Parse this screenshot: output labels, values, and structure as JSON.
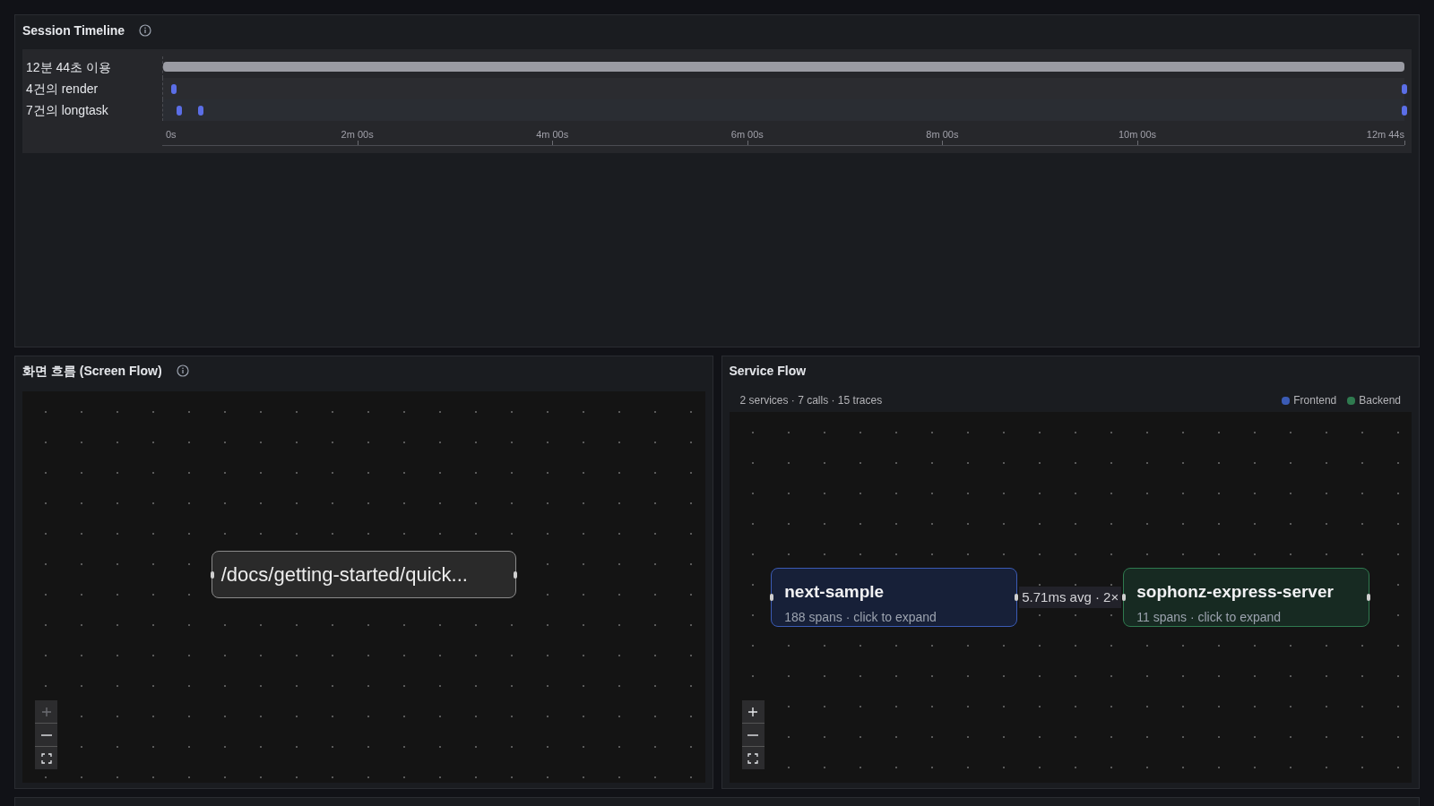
{
  "session_timeline": {
    "title": "Session Timeline",
    "rows": [
      {
        "kind": "span",
        "label": "12분 44초 이용",
        "level": 1
      },
      {
        "kind": "events",
        "label": "4건의 render",
        "markers": [
          {
            "level": 0.009
          },
          {
            "level": 1
          }
        ]
      },
      {
        "kind": "events",
        "label": "7건의 longtask",
        "markers": [
          {
            "level": 0.013
          },
          {
            "level": 0.03
          },
          {
            "level": 1
          }
        ]
      }
    ],
    "ticks": [
      {
        "label": "0s",
        "level": 0
      },
      {
        "label": "2m 00s",
        "level": 0.157
      },
      {
        "label": "4m 00s",
        "level": 0.314
      },
      {
        "label": "6m 00s",
        "level": 0.471
      },
      {
        "label": "8m 00s",
        "level": 0.628
      },
      {
        "label": "10m 00s",
        "level": 0.785
      },
      {
        "label": "12m 44s",
        "level": 1
      }
    ]
  },
  "screen_flow": {
    "title": "화면 흐름 (Screen Flow)",
    "nodes": [
      {
        "label": "/docs/getting-started/quick..."
      }
    ],
    "controls": [
      {
        "kind": "zoom-in",
        "disabled": true
      },
      {
        "kind": "zoom-out",
        "disabled": false
      },
      {
        "kind": "fit",
        "disabled": false
      }
    ]
  },
  "service_flow": {
    "title": "Service Flow",
    "summary": "2 services · 7 calls · 15 traces",
    "legend": [
      {
        "label": "Frontend",
        "color": "#3b5bb5"
      },
      {
        "label": "Backend",
        "color": "#2f7a4f"
      }
    ],
    "nodes": [
      {
        "kind": "frontend",
        "name": "next-sample",
        "detail": "188 spans · click to expand"
      },
      {
        "kind": "backend",
        "name": "sophonz-express-server",
        "detail": "11 spans · click to expand"
      }
    ],
    "edge": {
      "label": "5.71ms avg · 2×"
    },
    "controls": [
      {
        "kind": "zoom-in",
        "disabled": false
      },
      {
        "kind": "zoom-out",
        "disabled": false
      },
      {
        "kind": "fit",
        "disabled": false
      }
    ]
  }
}
